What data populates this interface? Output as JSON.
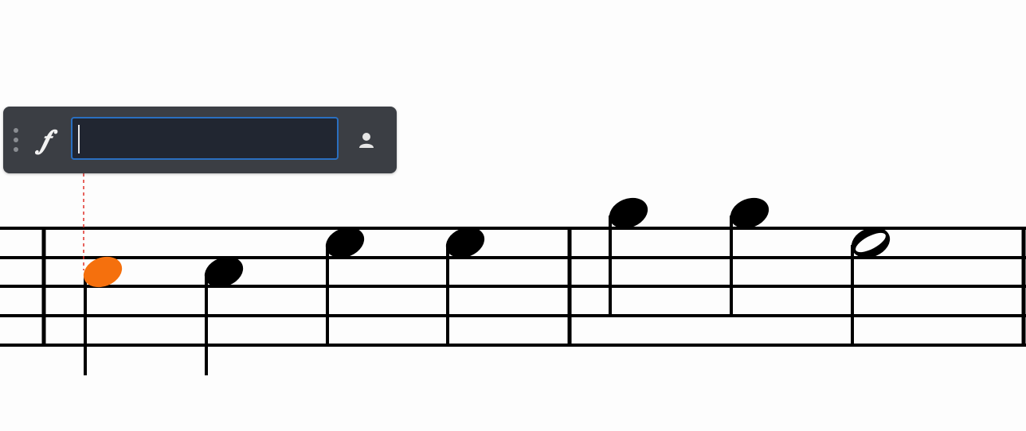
{
  "popover": {
    "dynamic_symbol": "𝆑",
    "input_value": "",
    "input_placeholder": "",
    "person_icon": "person-icon",
    "grip_icon": "drag-handle-icon"
  },
  "colors": {
    "selected_note": "#f5700d",
    "anchor_line": "#e0302a",
    "input_border": "#2a6fc0",
    "popover_bg": "#3b3e44"
  },
  "score": {
    "measures": [
      {
        "notes": [
          {
            "duration": "quarter",
            "selected": true
          },
          {
            "duration": "quarter",
            "selected": false
          },
          {
            "duration": "quarter",
            "selected": false
          },
          {
            "duration": "quarter",
            "selected": false
          }
        ]
      },
      {
        "notes": [
          {
            "duration": "quarter",
            "selected": false
          },
          {
            "duration": "quarter",
            "selected": false
          },
          {
            "duration": "half",
            "selected": false
          }
        ]
      }
    ]
  }
}
